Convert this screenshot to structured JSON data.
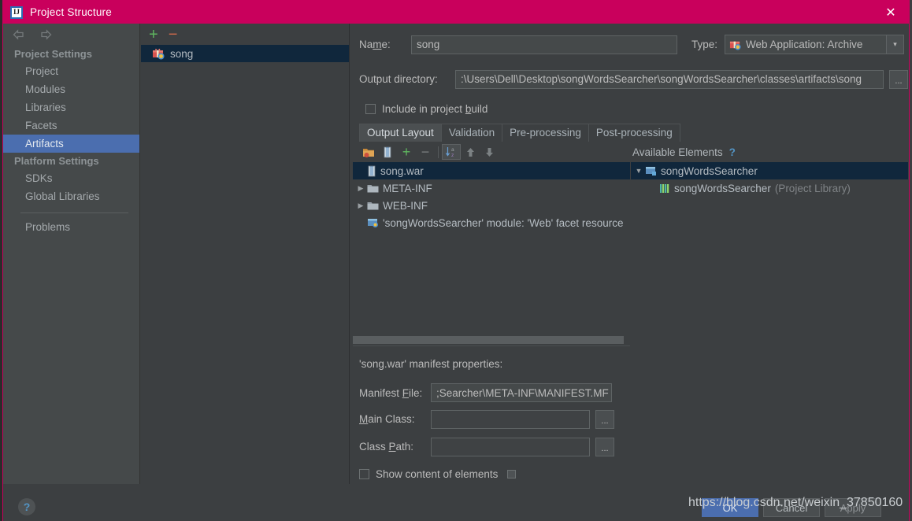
{
  "window": {
    "title": "Project Structure",
    "logo_text": "IJ",
    "close_icon": "✕"
  },
  "sidebar": {
    "back_icon": "back-arrow",
    "forward_icon": "forward-arrow",
    "groups": [
      {
        "header": "Project Settings",
        "items": [
          {
            "label": "Project",
            "selected": false
          },
          {
            "label": "Modules",
            "selected": false
          },
          {
            "label": "Libraries",
            "selected": false
          },
          {
            "label": "Facets",
            "selected": false
          },
          {
            "label": "Artifacts",
            "selected": true
          }
        ]
      },
      {
        "header": "Platform Settings",
        "items": [
          {
            "label": "SDKs",
            "selected": false
          },
          {
            "label": "Global Libraries",
            "selected": false
          }
        ]
      }
    ],
    "problems_label": "Problems"
  },
  "artifacts_panel": {
    "add_label": "+",
    "remove_label": "−",
    "items": [
      {
        "label": "song",
        "icon": "artifact-icon",
        "selected": true
      }
    ]
  },
  "detail": {
    "name_label": "Na",
    "name_label_underlined": "m",
    "name_label_rest": "e:",
    "name_value": "song",
    "type_label": "Type:",
    "type_value": "Web Application: Archive",
    "type_dropdown_icon": "▾",
    "output_dir_label": "Output directory:",
    "output_dir_value": ":\\Users\\Dell\\Desktop\\songWordsSearcher\\songWordsSearcher\\classes\\artifacts\\song",
    "browse_label": "...",
    "include_checkbox_label_a": "Include in project ",
    "include_checkbox_label_u": "b",
    "include_checkbox_label_b": "uild",
    "include_checked": false,
    "tabs": [
      {
        "label": "Output Layout",
        "active": true
      },
      {
        "label": "Validation",
        "active": false
      },
      {
        "label": "Pre-processing",
        "active": false
      },
      {
        "label": "Post-processing",
        "active": false
      }
    ],
    "tree_toolbar": [
      {
        "name": "add-directory-icon",
        "boxed": false
      },
      {
        "name": "add-archive-icon",
        "boxed": false
      },
      {
        "name": "add-plus-icon",
        "boxed": false
      },
      {
        "name": "remove-minus-icon",
        "boxed": false
      },
      {
        "name": "sort-az-icon",
        "boxed": true
      },
      {
        "name": "move-up-icon",
        "boxed": false
      },
      {
        "name": "move-down-icon",
        "boxed": false
      }
    ],
    "available_elements_label": "Available Elements",
    "available_help_label": "?",
    "output_tree": [
      {
        "label": "song.war",
        "depth": 0,
        "expander": "none",
        "icon": "archive-icon",
        "selected": true,
        "suffix": ""
      },
      {
        "label": "META-INF",
        "depth": 1,
        "expander": "collapsed",
        "icon": "folder-icon",
        "selected": false,
        "suffix": ""
      },
      {
        "label": "WEB-INF",
        "depth": 1,
        "expander": "collapsed",
        "icon": "folder-icon",
        "selected": false,
        "suffix": ""
      },
      {
        "label": "'songWordsSearcher' module: 'Web' facet resource",
        "depth": 1,
        "expander": "none",
        "icon": "module-facet-icon",
        "selected": false,
        "suffix": ""
      }
    ],
    "available_tree": [
      {
        "label": "songWordsSearcher",
        "depth": 0,
        "expander": "expanded",
        "icon": "module-icon",
        "selected": true,
        "suffix": ""
      },
      {
        "label": "songWordsSearcher",
        "depth": 1,
        "expander": "none",
        "icon": "library-icon",
        "selected": false,
        "suffix": "(Project Library)"
      }
    ],
    "manifest_title": "'song.war' manifest properties:",
    "manifest_file_label_a": "Manifest ",
    "manifest_file_label_u": "F",
    "manifest_file_label_b": "ile:",
    "manifest_file_value": ";Searcher\\META-INF\\MANIFEST.MF",
    "main_class_label_u": "M",
    "main_class_label_b": "ain Class:",
    "main_class_value": "",
    "class_path_label_a": "Class ",
    "class_path_label_u": "P",
    "class_path_label_b": "ath:",
    "class_path_value": "",
    "show_content_label": "Show content of elements",
    "show_content_checked": false
  },
  "bottom": {
    "help_label": "?",
    "ok_label": "OK",
    "cancel_label": "Cancel",
    "apply_label": "Apply"
  },
  "watermark": {
    "text": "https://blog.csdn.net/weixin_37850160"
  },
  "colors": {
    "titlebar": "#c9005c",
    "panel": "#3c3f41",
    "sidebar": "#45494a",
    "selection_blue": "#4b6eaf",
    "tree_selection": "#10273c",
    "accent_green": "#5fb65f",
    "accent_red": "#cf6a4c",
    "link_blue": "#5394c4"
  }
}
